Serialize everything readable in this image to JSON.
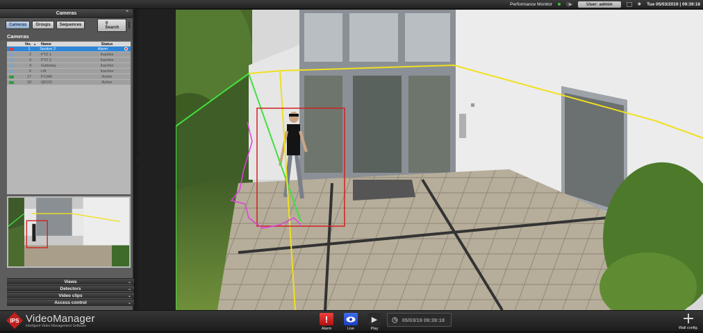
{
  "topbar": {
    "performance_label": "Performance Monitor",
    "user_label": "User: admin",
    "datetime": "Tue 05/03/2019 | 09:39:18"
  },
  "left_panel": {
    "header": "Cameras",
    "tabs": [
      {
        "label": "Cameras",
        "active": true
      },
      {
        "label": "Groups",
        "active": false
      },
      {
        "label": "Sequences",
        "active": false
      }
    ],
    "search_label": "Search",
    "list_title": "Cameras",
    "columns": [
      "No.",
      "Name",
      "Status"
    ],
    "sort_indicator": "▲",
    "cameras": [
      {
        "no": "1",
        "name": "Section 2",
        "status": "Alarm",
        "selected": true,
        "icon_color": "#e03b3b"
      },
      {
        "no": "2",
        "name": "PTZ 1",
        "status": "Inactive",
        "selected": false,
        "icon_color": "#7da3c9"
      },
      {
        "no": "3",
        "name": "PTZ 2",
        "status": "Inactive",
        "selected": false,
        "icon_color": "#7da3c9"
      },
      {
        "no": "4",
        "name": "Gateway",
        "status": "Inactive",
        "selected": false,
        "icon_color": "#7da3c9"
      },
      {
        "no": "5",
        "name": "Lift",
        "status": "Inactive",
        "selected": false,
        "icon_color": "#7da3c9"
      },
      {
        "no": "17",
        "name": "P1346",
        "status": "Active",
        "selected": false,
        "icon_color": "#2f9a3c"
      },
      {
        "no": "19",
        "name": "Q6115",
        "status": "Active",
        "selected": false,
        "icon_color": "#2f9a3c"
      }
    ],
    "accordions": [
      "Views",
      "Detectors",
      "Video clips",
      "Access control"
    ]
  },
  "bottombar": {
    "brand": "VideoManager",
    "brand_sub": "Intelligent Video Management Software",
    "logo_text": "IPS",
    "alarm_label": "Alarm",
    "live_label": "Live",
    "play_label": "Play",
    "time_display": "05/03/19  09:39:18",
    "wall_config_label": "Wall config."
  },
  "colors": {
    "accent_blue": "#2f86d6",
    "alarm_red": "#d92020",
    "live_blue": "#1f4fd8",
    "zone_yellow": "#f0e020",
    "zone_green": "#40e040",
    "track_magenta": "#e040e0",
    "bbox_red": "#d02020"
  }
}
